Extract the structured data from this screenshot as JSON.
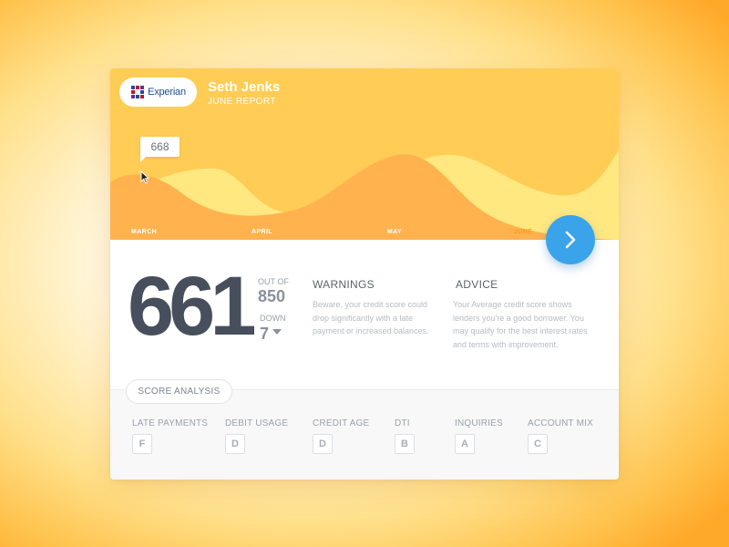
{
  "header": {
    "brand": "Experian",
    "user_name": "Seth Jenks",
    "report_label": "JUNE REPORT"
  },
  "chart": {
    "tooltip_value": "668",
    "months": [
      "MARCH",
      "APRIL",
      "MAY",
      "JUNE"
    ],
    "active_month": "JUNE"
  },
  "score": {
    "value": "661",
    "out_of_label": "OUT OF",
    "max": "850",
    "change_label": "DOWN",
    "change_value": "7"
  },
  "warnings": {
    "title": "WARNINGS",
    "text": "Beware, your credit score could drop significantly with a late payment or increased balances."
  },
  "advice": {
    "title": "ADVICE",
    "text": "Your Average credit score shows lenders you're a good borrower. You may qualify for the best interest rates and terms with improvement."
  },
  "analysis": {
    "title": "SCORE ANALYSIS",
    "metrics": [
      {
        "label": "LATE PAYMENTS",
        "grade": "F"
      },
      {
        "label": "DEBIT USAGE",
        "grade": "D"
      },
      {
        "label": "CREDIT AGE",
        "grade": "D"
      },
      {
        "label": "DTI",
        "grade": "B"
      },
      {
        "label": "INQUIRIES",
        "grade": "A"
      },
      {
        "label": "ACCOUNT MIX",
        "grade": "C"
      }
    ]
  },
  "icons": {
    "next": "chevron-right-icon",
    "cursor": "cursor-arrow-icon",
    "logo": "experian-logo-icon"
  },
  "colors": {
    "header_yellow": "#ffcc55",
    "wave_light": "#ffe880",
    "wave_orange": "#ffb24d",
    "accent_blue": "#3aa3ea",
    "score_text": "#484f5c"
  }
}
